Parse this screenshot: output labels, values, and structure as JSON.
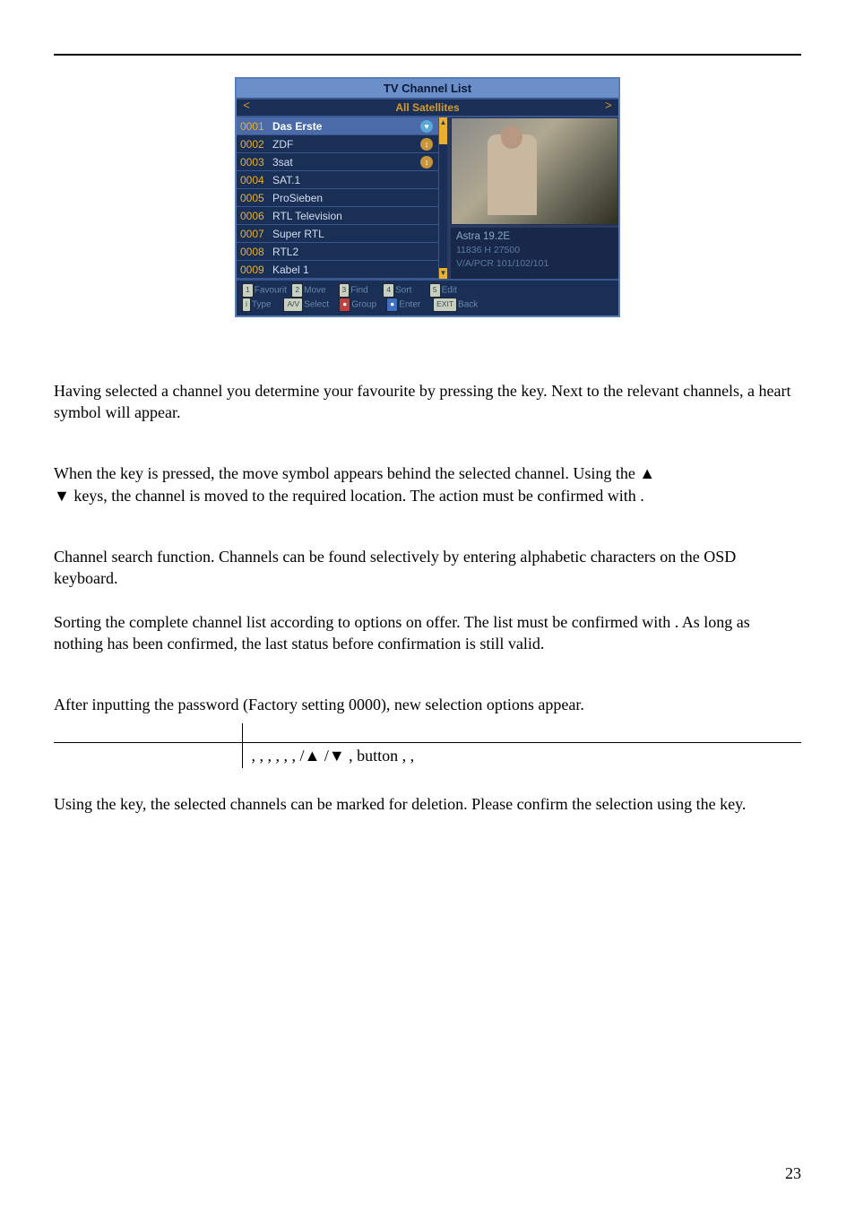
{
  "screenshot": {
    "title": "TV Channel List",
    "satellite_label": "All Satellites",
    "channels": [
      {
        "num": "0001",
        "name": "Das Erste",
        "heart": true,
        "selected": true
      },
      {
        "num": "0002",
        "name": "ZDF",
        "move": true
      },
      {
        "num": "0003",
        "name": "3sat",
        "move": true
      },
      {
        "num": "0004",
        "name": "SAT.1"
      },
      {
        "num": "0005",
        "name": "ProSieben"
      },
      {
        "num": "0006",
        "name": "RTL Television"
      },
      {
        "num": "0007",
        "name": "Super RTL"
      },
      {
        "num": "0008",
        "name": "RTL2"
      },
      {
        "num": "0009",
        "name": "Kabel 1"
      }
    ],
    "info": {
      "line1": "Astra 19.2E",
      "line2": "11836 H 27500",
      "line3": "V/A/PCR 101/102/101"
    },
    "footer": {
      "f1": "1",
      "f1_label": "Favourit",
      "f2": "2",
      "f2_label": "Move",
      "f3": "3",
      "f3_label": "Find",
      "f4": "4",
      "f4_label": "Sort",
      "f5": "5",
      "f5_label": "Edit",
      "fi": "i",
      "fi_label": "Type",
      "fav": "A/V",
      "fav_label": "Select",
      "fg": "●",
      "fg_label": "Group",
      "fe": "●",
      "fe_label": "Enter",
      "fx": "EXIT",
      "fx_label": "Back"
    }
  },
  "para1": "Having selected a channel you determine your favourite by pressing the    key. Next to the relevant channels, a heart symbol will appear.",
  "para2a": "When the    key is pressed, the move symbol appears behind the selected channel. Using the      ▲",
  "para2b": "    ▼ keys, the channel is moved to the required location. The action must be confirmed with      .",
  "para3": "Channel search function. Channels can be found selectively by entering alphabetic characters on the OSD keyboard.",
  "para4": "Sorting the complete channel list according to options on offer. The list must be confirmed with      . As long as nothing has been confirmed, the last status before confirmation is still valid.",
  "para5": "After inputting the password (Factory setting 0000), new selection options appear.",
  "table_row": "            ,             ,              ,                 ,             ,                  ,       /▲    /▼          ,                        button         ,                  ,",
  "para6": "Using the    key, the selected channels can be marked for deletion. Please confirm the selection using the       key.",
  "page_number": "23"
}
